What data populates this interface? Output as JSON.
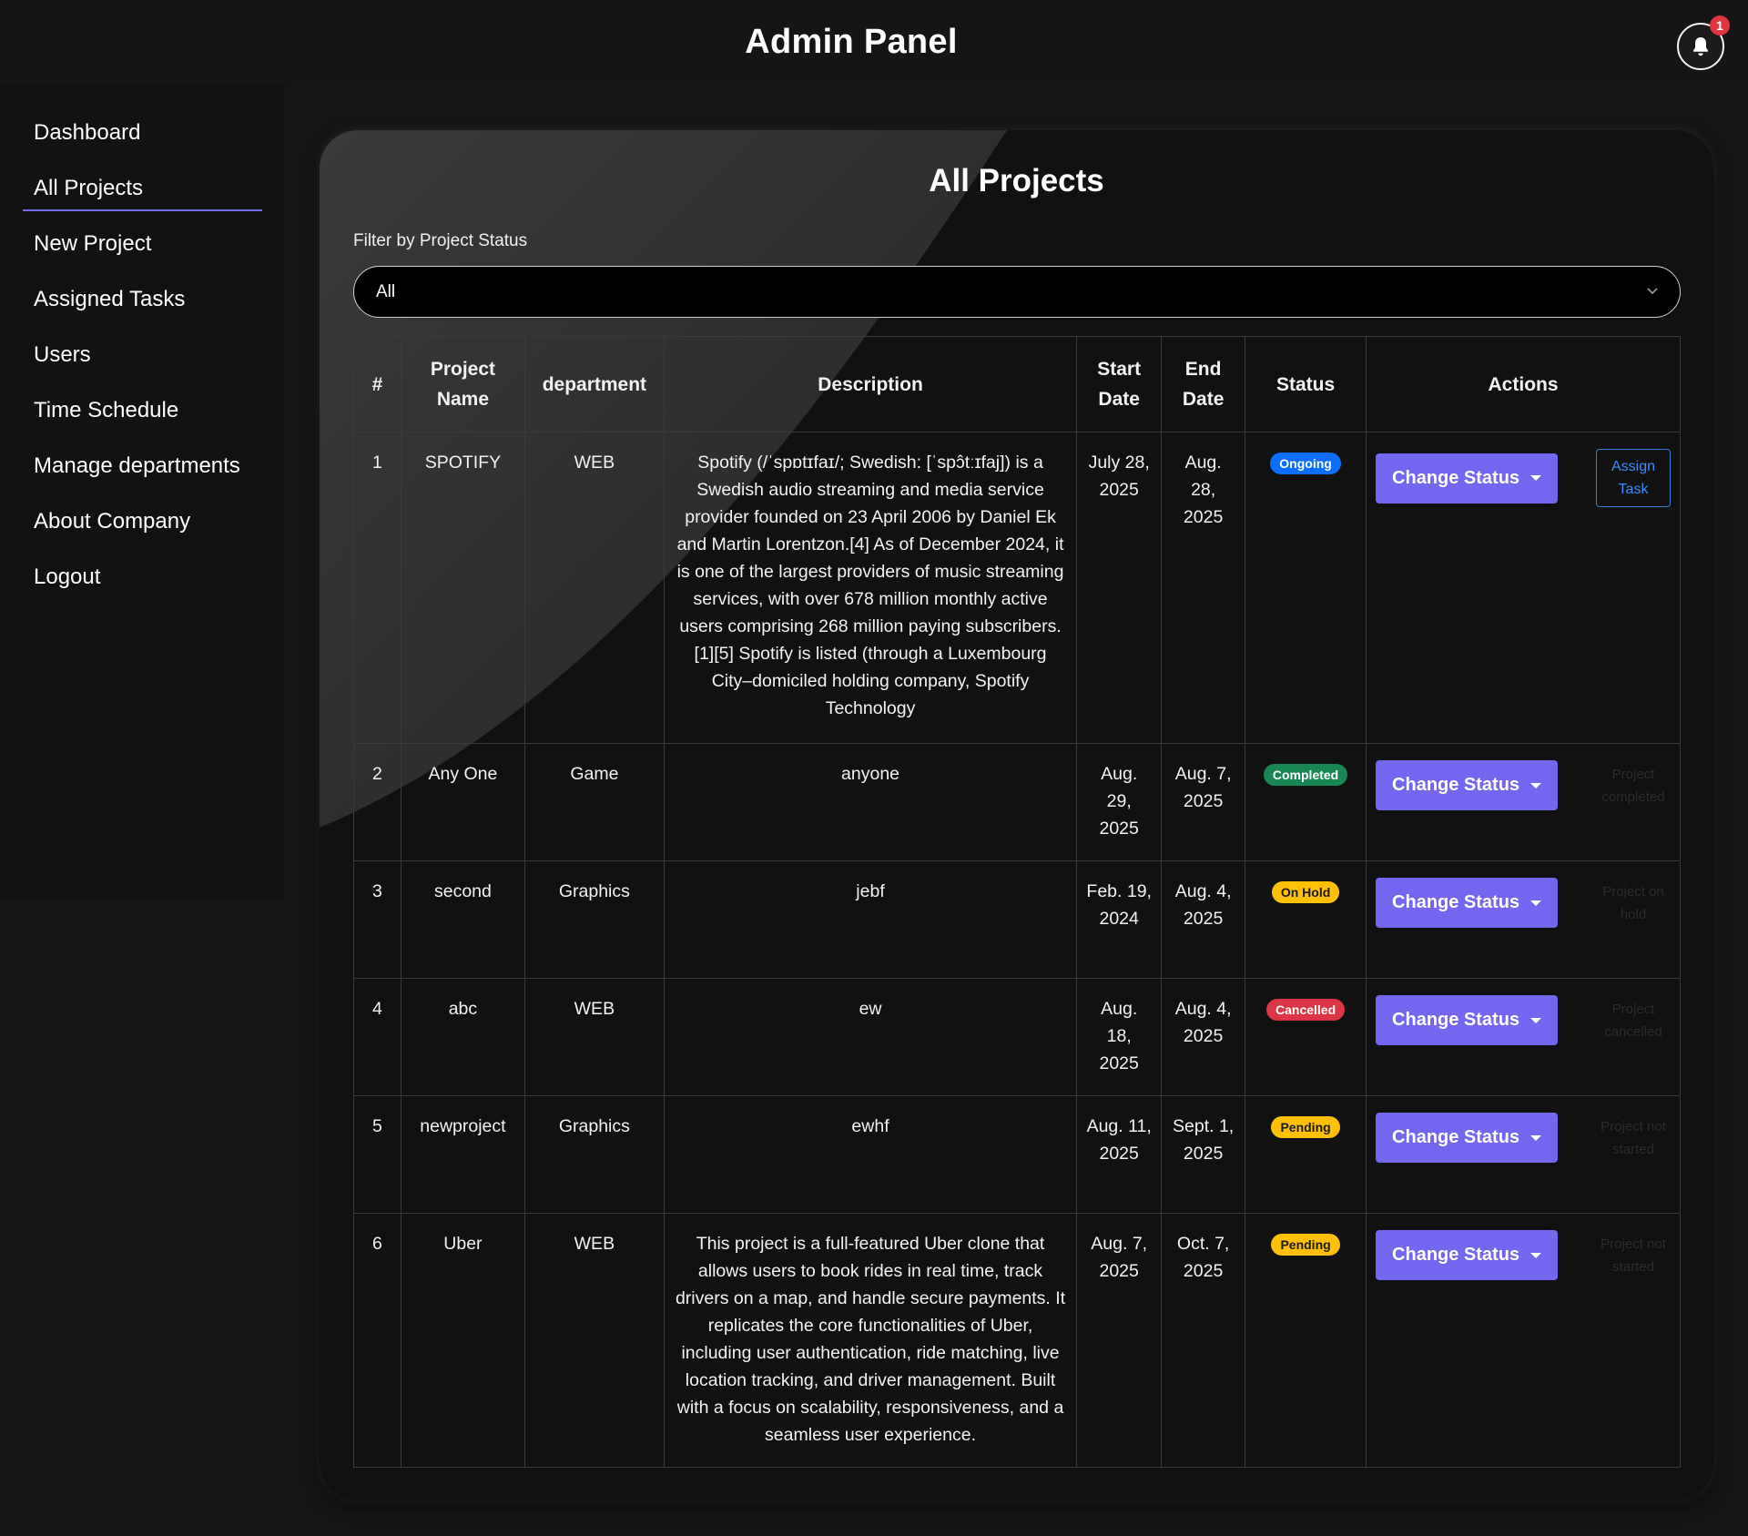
{
  "header": {
    "title": "Admin Panel",
    "notification_count": "1"
  },
  "sidebar": {
    "items": [
      {
        "label": "Dashboard"
      },
      {
        "label": "All Projects"
      },
      {
        "label": "New Project"
      },
      {
        "label": "Assigned Tasks"
      },
      {
        "label": "Users"
      },
      {
        "label": "Time Schedule"
      },
      {
        "label": "Manage departments"
      },
      {
        "label": "About Company"
      },
      {
        "label": "Logout"
      }
    ],
    "active_item": "All Projects"
  },
  "main": {
    "title": "All Projects",
    "filter": {
      "label": "Filter by Project Status",
      "selected": "All"
    },
    "table": {
      "headers": [
        "#",
        "Project Name",
        "department",
        "Description",
        "Start Date",
        "End Date",
        "Status",
        "Actions"
      ],
      "change_status_label": "Change Status",
      "rows": [
        {
          "num": "1",
          "name": "SPOTIFY",
          "department": "WEB",
          "description": "Spotify (/ˈspɒtɪfaɪ/; Swedish: [ˈspɔ̂tːɪfaj]) is a Swedish audio streaming and media service provider founded on 23 April 2006 by Daniel Ek and Martin Lorentzon.[4] As of December 2024, it is one of the largest providers of music streaming services, with over 678 million monthly active users comprising 268 million paying subscribers.[1][5] Spotify is listed (through a Luxembourg City–domiciled holding company, Spotify Technology",
          "start": "July 28, 2025",
          "end": "Aug. 28, 2025",
          "status": "Ongoing",
          "status_color": "#0d6efd",
          "action_extra": "Assign Task"
        },
        {
          "num": "2",
          "name": "Any One",
          "department": "Game",
          "description": "anyone",
          "start": "Aug. 29, 2025",
          "end": "Aug. 7, 2025",
          "status": "Completed",
          "status_color": "#198754",
          "action_extra": "Project completed"
        },
        {
          "num": "3",
          "name": "second",
          "department": "Graphics",
          "description": "jebf",
          "start": "Feb. 19, 2024",
          "end": "Aug. 4, 2025",
          "status": "On Hold",
          "status_color": "#ffc107",
          "action_extra": "Project on hold"
        },
        {
          "num": "4",
          "name": "abc",
          "department": "WEB",
          "description": "ew",
          "start": "Aug. 18, 2025",
          "end": "Aug. 4, 2025",
          "status": "Cancelled",
          "status_color": "#dc3545",
          "action_extra": "Project cancelled"
        },
        {
          "num": "5",
          "name": "newproject",
          "department": "Graphics",
          "description": "ewhf",
          "start": "Aug. 11, 2025",
          "end": "Sept. 1, 2025",
          "status": "Pending",
          "status_color": "#ffc107",
          "action_extra": "Project not started"
        },
        {
          "num": "6",
          "name": "Uber",
          "department": "WEB",
          "description": "This project is a full-featured Uber clone that allows users to book rides in real time, track drivers on a map, and handle secure payments. It replicates the core functionalities of Uber, including user authentication, ride matching, live location tracking, and driver management. Built with a focus on scalability, responsiveness, and a seamless user experience.",
          "start": "Aug. 7, 2025",
          "end": "Oct. 7, 2025",
          "status": "Pending",
          "status_color": "#ffc107",
          "action_extra": "Project not started"
        }
      ]
    }
  },
  "colors": {
    "accent": "#7367f0",
    "background": "#161616",
    "card": "#111111",
    "badge_red": "#e0343f"
  },
  "icons": {
    "notification": "bell-icon",
    "dropdown": "chevron-down-icon"
  }
}
